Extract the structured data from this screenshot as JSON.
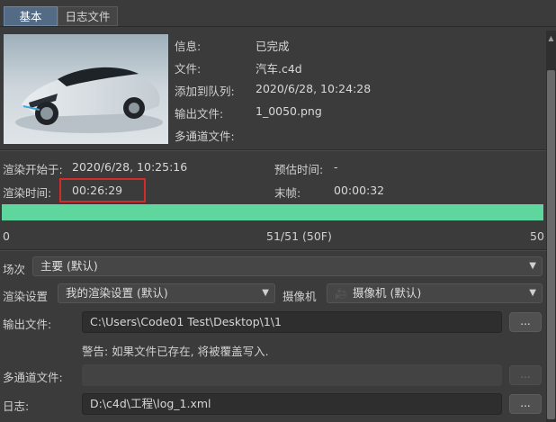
{
  "tabs": [
    {
      "label": "基本",
      "active": true
    },
    {
      "label": "日志文件",
      "active": false
    }
  ],
  "info": {
    "status_label": "信息:",
    "status_value": "已完成",
    "file_label": "文件:",
    "file_value": "汽车.c4d",
    "queued_label": "添加到队列:",
    "queued_value": "2020/6/28, 10:24:28",
    "output_label": "输出文件:",
    "output_value": "1_0050.png",
    "multipass_label": "多通道文件:"
  },
  "render": {
    "start_label": "渲染开始于:",
    "start_value": "2020/6/28, 10:25:16",
    "eta_label": "预估时间:",
    "eta_value": "-",
    "time_label": "渲染时间:",
    "time_value": "00:26:29",
    "lastframe_label": "末帧:",
    "lastframe_value": "00:00:32"
  },
  "progress": {
    "fraction": 1.0,
    "min_label": "0",
    "mid_label": "51/51 (50F)",
    "max_label": "50"
  },
  "settings": {
    "take_label": "场次",
    "take_value": "主要 (默认)",
    "render_settings_label": "渲染设置",
    "render_settings_value": "我的渲染设置 (默认)",
    "camera_label": "摄像机",
    "camera_value": "摄像机 (默认)",
    "output_file_label": "输出文件:",
    "output_file_value": "C:\\Users\\Code01 Test\\Desktop\\1\\1",
    "warning": "警告: 如果文件已存在, 将被覆盖写入.",
    "multipass_label": "多通道文件:",
    "multipass_value": "",
    "log_label": "日志:",
    "log_value": "D:\\c4d\\工程\\log_1.xml",
    "browse_label": "..."
  },
  "colors": {
    "progress": "#5fd69e",
    "tab_active": "#536b85",
    "highlight": "#d42a2a"
  }
}
